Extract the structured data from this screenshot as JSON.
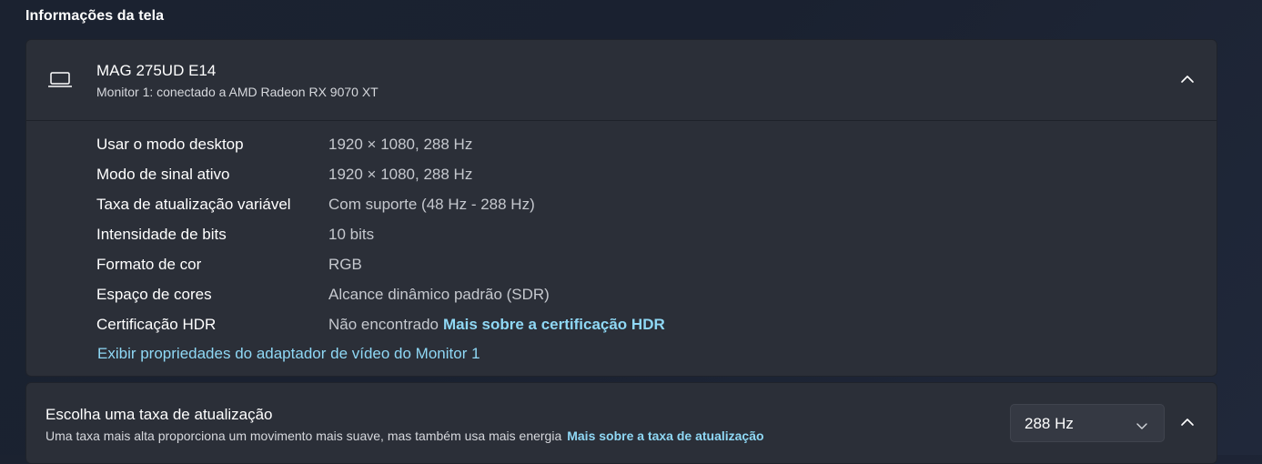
{
  "section_title": "Informações da tela",
  "display_card": {
    "icon": "laptop-icon",
    "monitor_name": "MAG 275UD E14",
    "monitor_subtitle": "Monitor 1: conectado a AMD Radeon RX 9070 XT",
    "collapse_icon": "chevron-up-icon",
    "details": [
      {
        "label": "Usar o modo desktop",
        "value": "1920 × 1080, 288 Hz"
      },
      {
        "label": "Modo de sinal ativo",
        "value": "1920 × 1080, 288 Hz"
      },
      {
        "label": "Taxa de atualização variável",
        "value": "Com suporte (48 Hz - 288 Hz)"
      },
      {
        "label": "Intensidade de bits",
        "value": "10 bits"
      },
      {
        "label": "Formato de cor",
        "value": "RGB"
      },
      {
        "label": "Espaço de cores",
        "value": "Alcance dinâmico padrão (SDR)"
      },
      {
        "label": "Certificação HDR",
        "value": "Não encontrado",
        "link": "Mais sobre a certificação HDR"
      }
    ],
    "adapter_link": "Exibir propriedades do adaptador de vídeo do Monitor 1"
  },
  "refresh_card": {
    "title": "Escolha uma taxa de atualização",
    "subtitle": "Uma taxa mais alta proporciona um movimento mais suave, mas também usa mais energia",
    "subtitle_link": "Mais sobre a taxa de atualização",
    "selected_rate": "288 Hz",
    "dropdown_icon": "chevron-down-icon",
    "collapse_icon": "chevron-up-icon"
  },
  "colors": {
    "background": "#1b2230",
    "card": "#2b2f38",
    "link": "#8fd8f5",
    "value_text": "#c5c8ce"
  }
}
